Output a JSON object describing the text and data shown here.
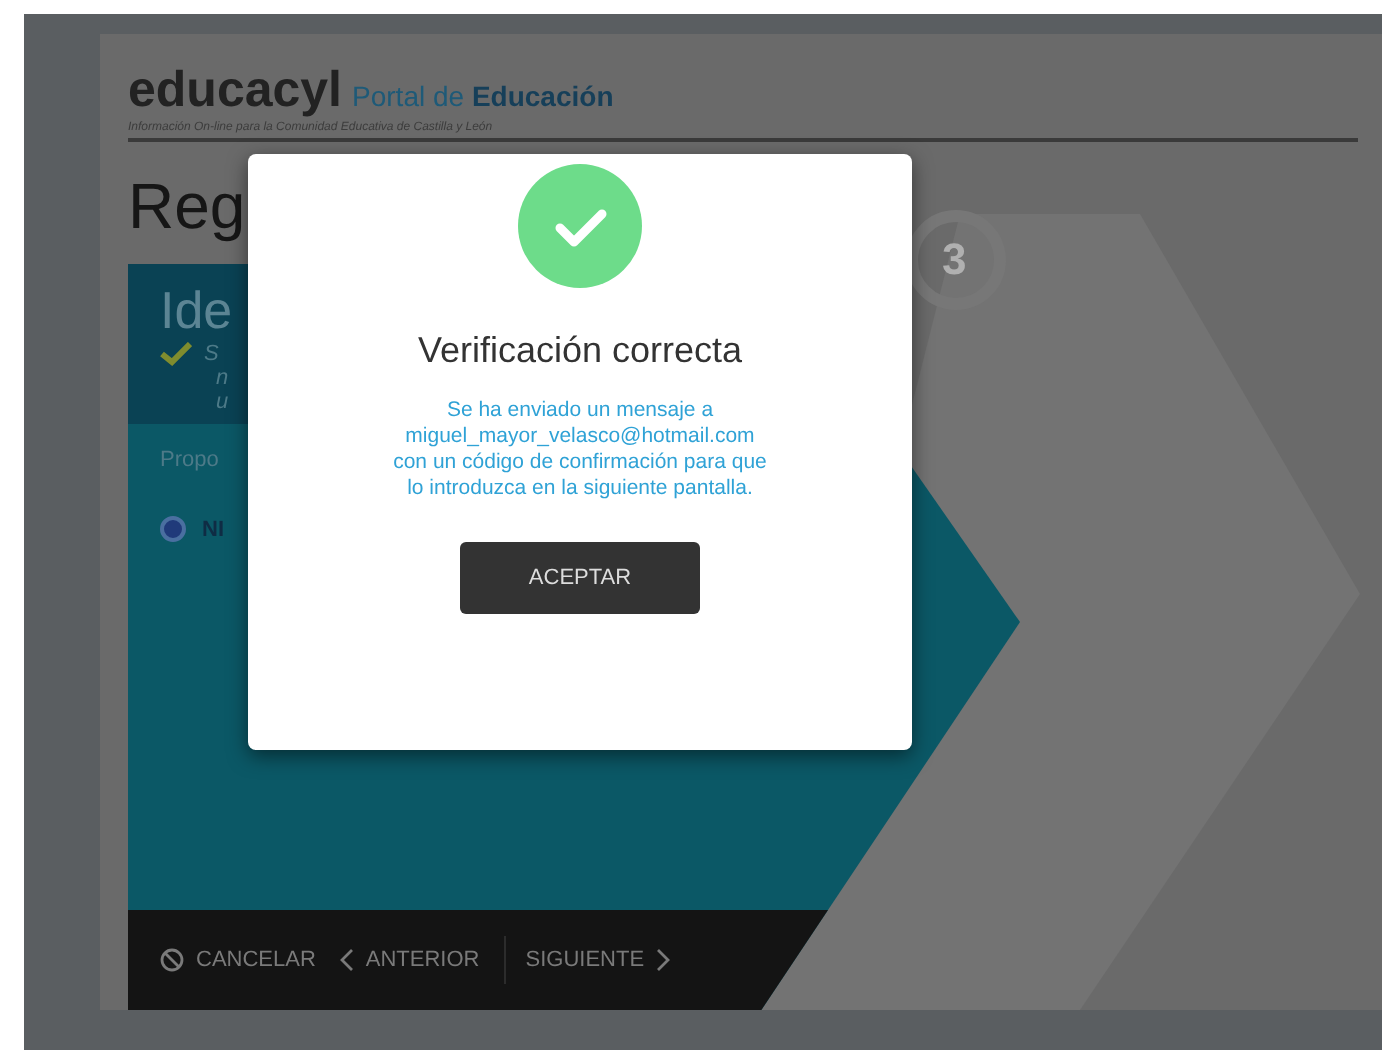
{
  "header": {
    "brand": "educacyl",
    "portal_prefix": "Portal de ",
    "portal_name": "Educación",
    "tagline": "Información On-line para la Comunidad Educativa de Castilla y León"
  },
  "page_title": "Reg",
  "step": {
    "number": "3"
  },
  "card": {
    "title": "Ide",
    "status_lines": [
      "S",
      "n",
      "u"
    ],
    "prompt": "Propo",
    "options": [
      {
        "label": "NI",
        "selected": true
      }
    ]
  },
  "footer_buttons": [
    {
      "kind": "cancel",
      "label": "CANCELAR"
    },
    {
      "kind": "back",
      "label": "ANTERIOR"
    },
    {
      "kind": "next",
      "label": "SIGUIENTE"
    }
  ],
  "dialog": {
    "title": "Verificación correcta",
    "message_lines": [
      "Se ha enviado un mensaje a",
      "miguel_mayor_velasco@hotmail.com",
      "con un código de confirmación para que",
      "lo introduzca en la siguiente pantalla."
    ],
    "button": "ACEPTAR"
  }
}
